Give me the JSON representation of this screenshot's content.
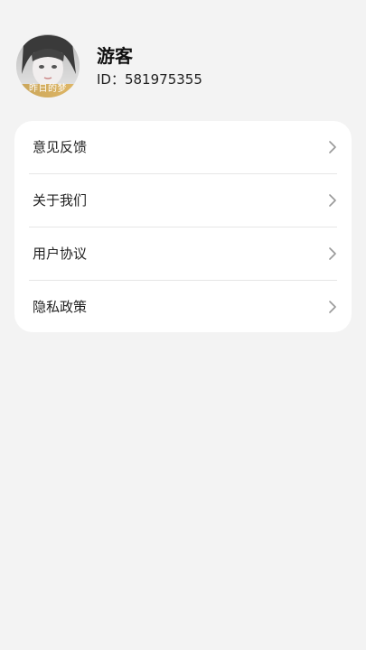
{
  "profile": {
    "avatar_caption": "昨日的梦",
    "name": "游客",
    "id_text": "ID：581975355"
  },
  "menu": {
    "items": [
      {
        "label": "意见反馈",
        "icon": "chevron-right-icon"
      },
      {
        "label": "关于我们",
        "icon": "chevron-right-icon"
      },
      {
        "label": "用户协议",
        "icon": "chevron-right-icon"
      },
      {
        "label": "隐私政策",
        "icon": "chevron-right-icon"
      }
    ]
  },
  "colors": {
    "background": "#f3f3f3",
    "card": "#ffffff",
    "text": "#222222",
    "chevron": "#999999",
    "divider": "#e6e6e6"
  }
}
